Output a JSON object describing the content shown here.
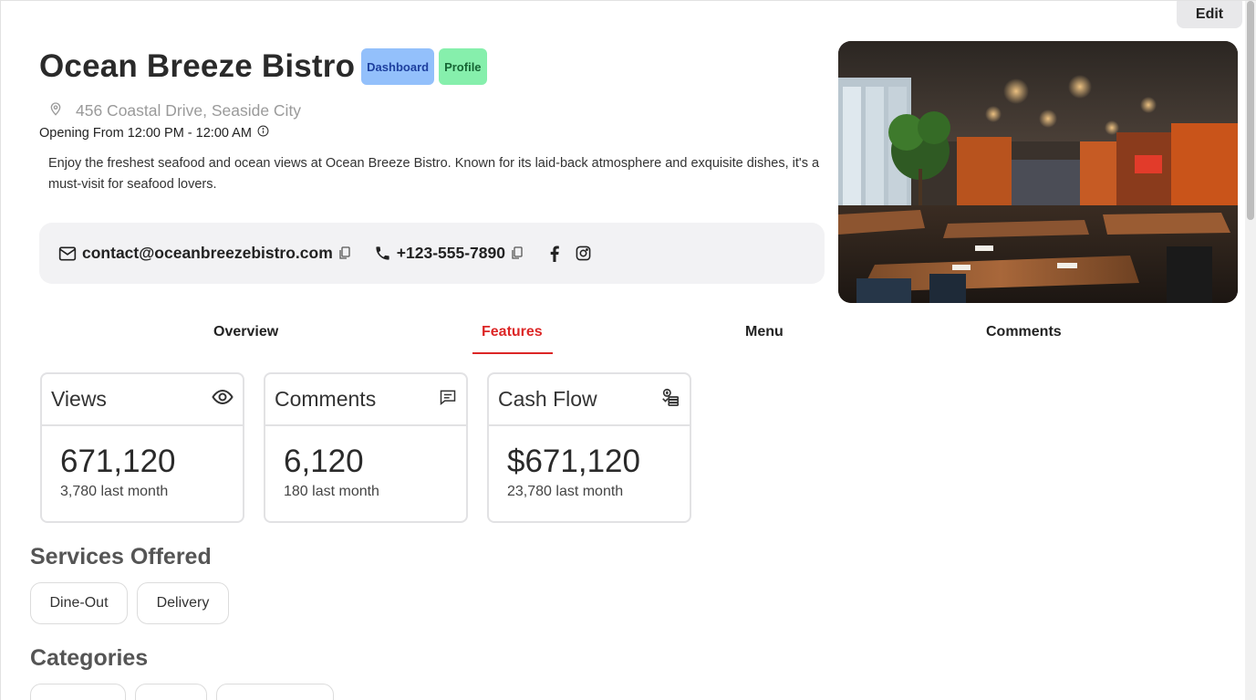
{
  "header": {
    "edit_label": "Edit",
    "title": "Ocean Breeze Bistro",
    "badges": [
      "Dashboard",
      "Profile"
    ],
    "address": "456 Coastal Drive, Seaside City",
    "hours": "Opening From 12:00 PM - 12:00 AM",
    "description": "Enjoy the freshest seafood and ocean views at Ocean Breeze Bistro. Known for its laid-back atmosphere and exquisite dishes, it's a must-visit for seafood lovers."
  },
  "contact": {
    "email": "contact@oceanbreezebistro.com",
    "phone": "+123-555-7890",
    "socials": [
      "facebook-icon",
      "instagram-icon"
    ]
  },
  "tabs": [
    {
      "label": "Overview",
      "active": false
    },
    {
      "label": "Features",
      "active": true
    },
    {
      "label": "Menu",
      "active": false
    },
    {
      "label": "Comments",
      "active": false
    }
  ],
  "stats": [
    {
      "title": "Views",
      "icon": "eye-icon",
      "value": "671,120",
      "sub": "3,780 last month"
    },
    {
      "title": "Comments",
      "icon": "comment-icon",
      "value": "6,120",
      "sub": "180 last month"
    },
    {
      "title": "Cash Flow",
      "icon": "cash-icon",
      "value": "$671,120",
      "sub": "23,780 last month"
    }
  ],
  "services": {
    "title": "Services Offered",
    "items": [
      "Dine-Out",
      "Delivery"
    ]
  },
  "categories": {
    "title": "Categories"
  },
  "colors": {
    "accent": "#dc2626",
    "badge_blue": "#93c0fb",
    "badge_green": "#86efac"
  }
}
